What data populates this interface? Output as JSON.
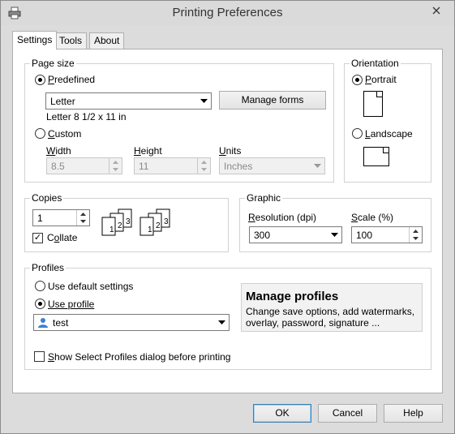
{
  "window": {
    "title": "Printing Preferences"
  },
  "tabs": [
    {
      "label": "Settings"
    },
    {
      "label": "Tools"
    },
    {
      "label": "About"
    }
  ],
  "page_size": {
    "legend": "Page size",
    "predefined_label": "Predefined",
    "predefined_selected": true,
    "form_value": "Letter",
    "manage_forms_label": "Manage forms",
    "form_description": "Letter 8 1/2 x 11 in",
    "custom_label": "Custom",
    "width_label": "Width",
    "width_value": "8.5",
    "height_label": "Height",
    "height_value": "11",
    "units_label": "Units",
    "units_value": "Inches"
  },
  "orientation": {
    "legend": "Orientation",
    "portrait_label": "Portrait",
    "portrait_selected": true,
    "landscape_label": "Landscape"
  },
  "copies": {
    "legend": "Copies",
    "value": "1",
    "collate_label": "Collate",
    "collate_checked": true,
    "collate_icon_digits": [
      "1",
      "2",
      "3"
    ]
  },
  "graphic": {
    "legend": "Graphic",
    "resolution_label": "Resolution (dpi)",
    "resolution_value": "300",
    "scale_label": "Scale (%)",
    "scale_value": "100"
  },
  "profiles": {
    "legend": "Profiles",
    "use_default_label": "Use default settings",
    "use_profile_label": "Use profile",
    "use_profile_selected": true,
    "profile_value": "test",
    "manage_title": "Manage profiles",
    "manage_desc_line1": "Change save options, add watermarks,",
    "manage_desc_line2": "overlay, password, signature ...",
    "show_dialog_label": "Show Select Profiles dialog before printing",
    "show_dialog_checked": false
  },
  "buttons": {
    "ok": "OK",
    "cancel": "Cancel",
    "help": "Help"
  },
  "icons": {
    "app": "printer-icon",
    "close": "close-icon",
    "dropdown": "chevron-down-icon",
    "spin_up": "spin-up-icon",
    "spin_down": "spin-down-icon",
    "user": "user-icon"
  }
}
